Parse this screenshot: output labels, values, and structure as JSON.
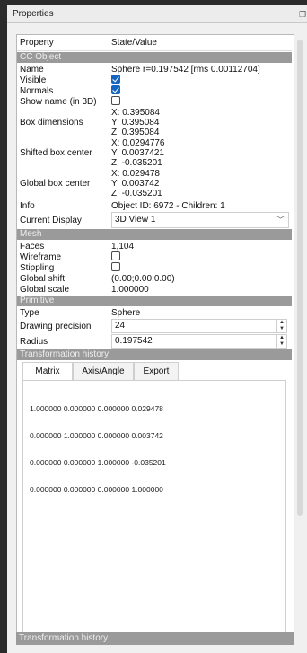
{
  "window": {
    "title": "Properties"
  },
  "header": {
    "col1": "Property",
    "col2": "State/Value"
  },
  "sections": {
    "cc_object": "CC Object",
    "mesh": "Mesh",
    "primitive": "Primitive",
    "transformation": "Transformation history",
    "bottom": "Transformation history"
  },
  "cc_object": {
    "name_label": "Name",
    "name_value": "Sphere r=0.197542 [rms 0.00112704]",
    "visible_label": "Visible",
    "visible_checked": true,
    "normals_label": "Normals",
    "normals_checked": true,
    "showname_label": "Show name (in 3D)",
    "showname_checked": false,
    "box_dim_label": "Box dimensions",
    "box_dim": [
      "X: 0.395084",
      "Y: 0.395084",
      "Z: 0.395084"
    ],
    "shifted_label": "Shifted box center",
    "shifted": [
      "X: 0.0294776",
      "Y: 0.0037421",
      "Z: -0.035201"
    ],
    "global_label": "Global box center",
    "global": [
      "X: 0.029478",
      "Y: 0.003742",
      "Z: -0.035201"
    ],
    "info_label": "Info",
    "info_value": "Object ID: 6972 - Children: 1",
    "display_label": "Current Display",
    "display_value": "3D View 1"
  },
  "mesh": {
    "faces_label": "Faces",
    "faces_value": "1,104",
    "wireframe_label": "Wireframe",
    "wireframe_checked": false,
    "stippling_label": "Stippling",
    "stippling_checked": false,
    "gshift_label": "Global shift",
    "gshift_value": "(0.00;0.00;0.00)",
    "gscale_label": "Global scale",
    "gscale_value": "1.000000"
  },
  "primitive": {
    "type_label": "Type",
    "type_value": "Sphere",
    "precision_label": "Drawing precision",
    "precision_value": "24",
    "radius_label": "Radius",
    "radius_value": "0.197542"
  },
  "tabs": [
    "Matrix",
    "Axis/Angle",
    "Export"
  ],
  "matrix": [
    "1.000000 0.000000 0.000000 0.029478",
    "0.000000 1.000000 0.000000 0.003742",
    "0.000000 0.000000 1.000000 -0.035201",
    "0.000000 0.000000 0.000000 1.000000"
  ],
  "colors": {
    "section_bg": "#9a9a9a",
    "checkbox_on": "#1565c0"
  }
}
